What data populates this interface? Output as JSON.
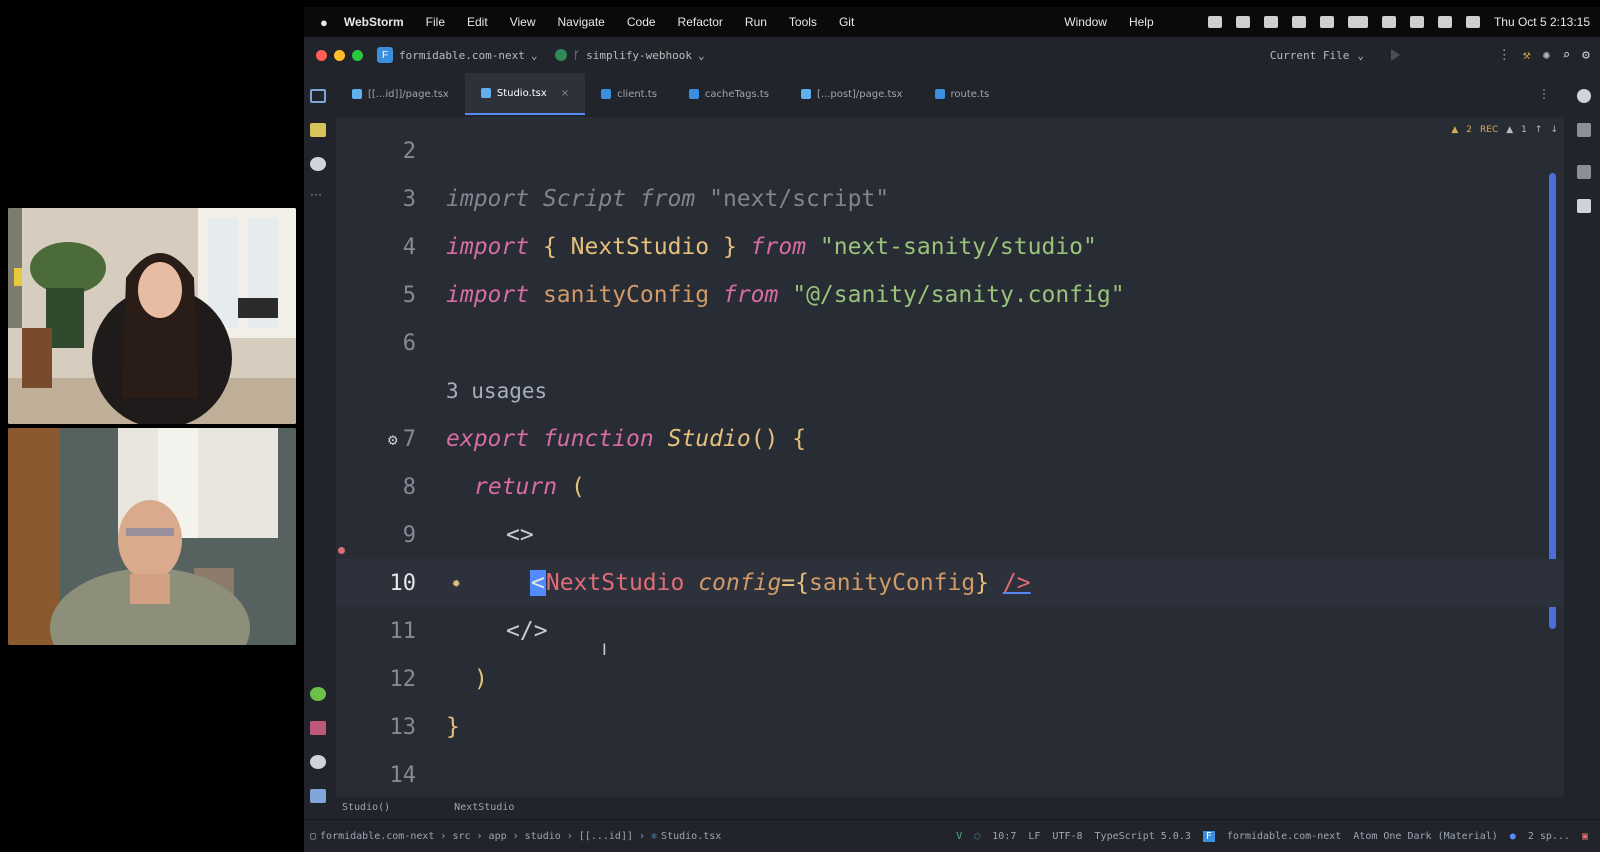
{
  "menubar": {
    "app_name": "WebStorm",
    "items": [
      "File",
      "Edit",
      "View",
      "Navigate",
      "Code",
      "Refactor",
      "Run",
      "Tools",
      "Git"
    ],
    "right_items": [
      "Window",
      "Help"
    ],
    "datetime": "Thu Oct 5  2:13:15"
  },
  "titlebar": {
    "project": "formidable.com-next",
    "project_icon_letter": "F",
    "branch": "simplify-webhook",
    "run_config": "Current File"
  },
  "tabs": [
    {
      "label": "[[...id]]/page.tsx",
      "color": "#61afef",
      "active": false
    },
    {
      "label": "Studio.tsx",
      "color": "#61afef",
      "active": true
    },
    {
      "label": "client.ts",
      "color": "#3b8fe0",
      "active": false
    },
    {
      "label": "cacheTags.ts",
      "color": "#3b8fe0",
      "active": false
    },
    {
      "label": "[...post]/page.tsx",
      "color": "#61afef",
      "active": false
    },
    {
      "label": "route.ts",
      "color": "#3b8fe0",
      "active": false
    }
  ],
  "inspections": {
    "warnings": "2",
    "rec": "REC",
    "weak": "1"
  },
  "code": {
    "lines": [
      {
        "n": "2"
      },
      {
        "n": "3",
        "t1": "import Script from ",
        "t2": "\"next/script\""
      },
      {
        "n": "4",
        "k1": "import",
        "p1": " { ",
        "c1": "NextStudio",
        "p2": " } ",
        "k2": "from",
        "s1": "\"next-sanity/studio\""
      },
      {
        "n": "5",
        "k1": "import",
        "v1": "sanityConfig",
        "k2": "from",
        "s1": "\"@/sanity/sanity.config\""
      },
      {
        "n": "6"
      },
      {
        "usages": "3 usages"
      },
      {
        "n": "7",
        "k1": "export",
        "k2": "function",
        "f1": "Studio",
        "p1": "() {"
      },
      {
        "n": "8",
        "k1": "return",
        "p1": " ("
      },
      {
        "n": "9",
        "p1": "<>"
      },
      {
        "n": "10",
        "lt": "<",
        "tag": "NextStudio",
        "attr": "config",
        "eq": "={",
        "v1": "sanityConfig",
        "rb": "}",
        "close": "/>"
      },
      {
        "n": "11",
        "p1": "</>"
      },
      {
        "n": "12",
        "p1": ")"
      },
      {
        "n": "13",
        "p1": "}"
      },
      {
        "n": "14"
      }
    ]
  },
  "breadcrumb": {
    "a": "Studio()",
    "b": "NextStudio"
  },
  "statusbar": {
    "path": [
      "formidable.com-next",
      "src",
      "app",
      "studio",
      "[[...id]]",
      "Studio.tsx"
    ],
    "position": "10:7",
    "line_sep": "LF",
    "encoding": "UTF-8",
    "language": "TypeScript 5.0.3",
    "project_label": "formidable.com-next",
    "theme": "Atom One Dark (Material)",
    "spaces": "2 sp..."
  }
}
